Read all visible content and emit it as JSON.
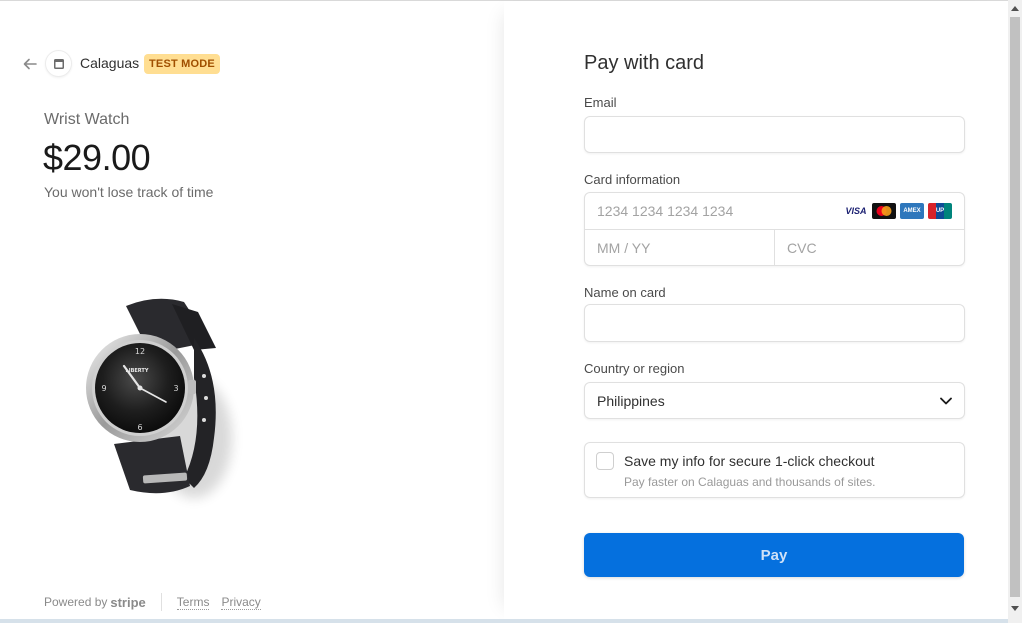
{
  "merchant": {
    "name": "Calaguas",
    "badge": "TEST MODE",
    "back_icon": "arrow-left-icon",
    "store_icon": "storefront-icon"
  },
  "product": {
    "name": "Wrist Watch",
    "price": "$29.00",
    "description": "You won't lose track of time",
    "image_icon": "wrist-watch-image"
  },
  "footer": {
    "powered_by": "Powered by",
    "brand": "stripe",
    "terms": "Terms",
    "privacy": "Privacy"
  },
  "form": {
    "title": "Pay with card",
    "email_label": "Email",
    "email_value": "",
    "card_label": "Card information",
    "card_number_placeholder": "1234 1234 1234 1234",
    "card_exp_placeholder": "MM / YY",
    "card_cvc_placeholder": "CVC",
    "card_brands": [
      "visa-icon",
      "mastercard-icon",
      "amex-icon",
      "unionpay-icon"
    ],
    "name_label": "Name on card",
    "name_value": "",
    "country_label": "Country or region",
    "country_value": "Philippines",
    "save_title": "Save my info for secure 1-click checkout",
    "save_subtitle": "Pay faster on Calaguas and thousands of sites.",
    "save_checked": false,
    "pay_label": "Pay"
  },
  "colors": {
    "accent": "#0570de",
    "badge_bg": "#ffde92",
    "badge_text": "#a04f00"
  }
}
